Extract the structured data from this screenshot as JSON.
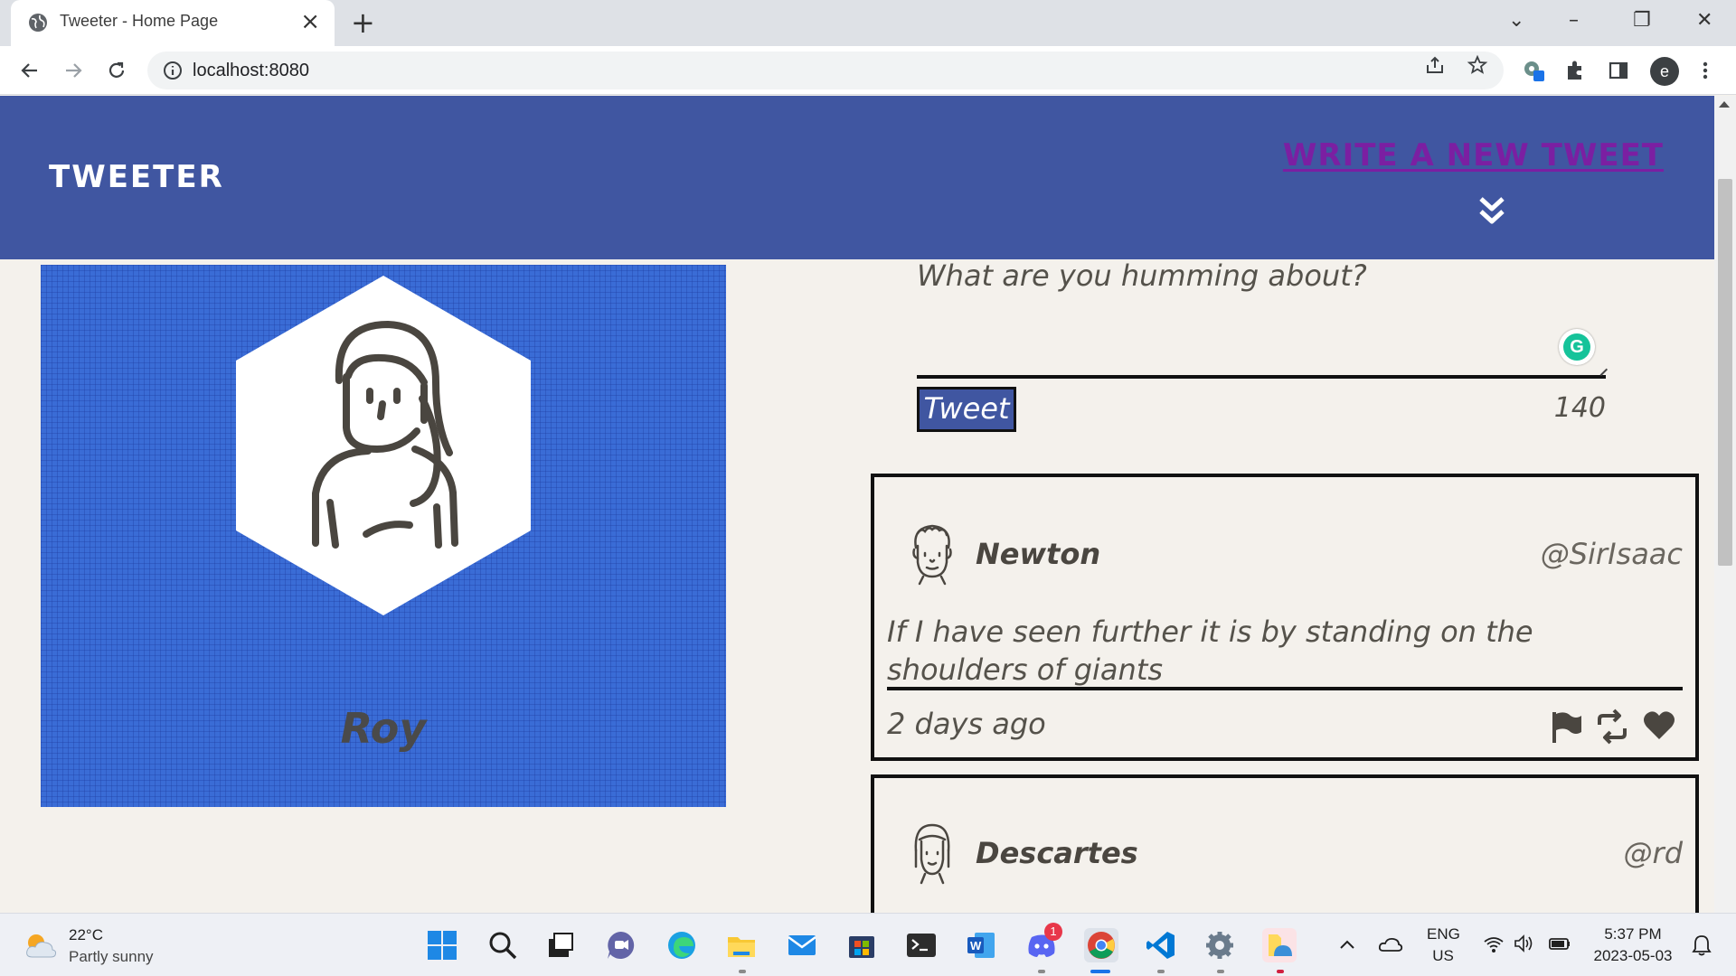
{
  "browser": {
    "tab_title": "Tweeter - Home Page",
    "tab_close": "×",
    "new_tab": "+",
    "url": "localhost:8080",
    "profile_initial": "e",
    "window_controls": {
      "minimize": "–",
      "restore": "❐",
      "close": "✕",
      "tab_search": "⌄"
    }
  },
  "header": {
    "brand": "TWEETER",
    "compose_link": "WRITE A NEW TWEET"
  },
  "profile": {
    "name": "Roy"
  },
  "compose": {
    "placeholder": "What are you humming about?",
    "button_label": "Tweet",
    "counter": "140"
  },
  "tweets": [
    {
      "name": "Newton",
      "handle": "@SirIsaac",
      "content": "If I have seen further it is by standing on the shoulders of giants",
      "time": "2 days ago"
    },
    {
      "name": "Descartes",
      "handle": "@rd"
    }
  ],
  "taskbar": {
    "weather_temp": "22°C",
    "weather_desc": "Partly sunny",
    "lang_top": "ENG",
    "lang_bottom": "US",
    "time": "5:37 PM",
    "date": "2023-05-03",
    "discord_badge": "1"
  },
  "colors": {
    "header_bg": "#4056a1",
    "page_bg": "#f4f1ec",
    "profile_bg": "#3a6cd6",
    "compose_link": "#7b1fa2"
  }
}
